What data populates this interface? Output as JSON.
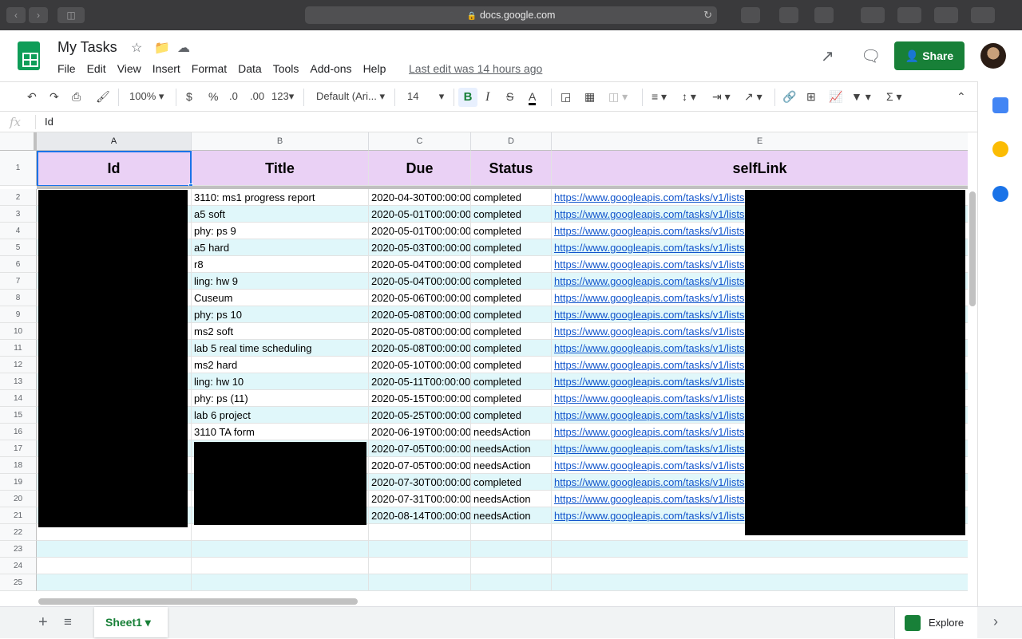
{
  "browser": {
    "url": "docs.google.com"
  },
  "header": {
    "title": "My Tasks",
    "menus": [
      "File",
      "Edit",
      "View",
      "Insert",
      "Format",
      "Data",
      "Tools",
      "Add-ons",
      "Help"
    ],
    "last_edit": "Last edit was 14 hours ago",
    "share_label": "Share"
  },
  "toolbar": {
    "zoom": "100%",
    "currency": "$",
    "percent": "%",
    "dec_less": ".0",
    "dec_more": ".00",
    "more_formats": "123",
    "font": "Default (Ari...",
    "font_size": "14",
    "bold": "B",
    "italic": "I",
    "strike": "S",
    "textcolor": "A"
  },
  "formula_bar": {
    "fx": "fx",
    "value": "Id"
  },
  "columns": [
    "A",
    "B",
    "C",
    "D",
    "E"
  ],
  "header_row": [
    "Id",
    "Title",
    "Due",
    "Status",
    "selfLink"
  ],
  "rows": [
    [
      "",
      "3110: ms1 progress report",
      "2020-04-30T00:00:00",
      "completed",
      "https://www.googleapis.com/tasks/v1/lists"
    ],
    [
      "",
      "a5 soft",
      "2020-05-01T00:00:00",
      "completed",
      "https://www.googleapis.com/tasks/v1/lists"
    ],
    [
      "",
      "phy: ps 9",
      "2020-05-01T00:00:00",
      "completed",
      "https://www.googleapis.com/tasks/v1/lists"
    ],
    [
      "",
      "a5 hard",
      "2020-05-03T00:00:00",
      "completed",
      "https://www.googleapis.com/tasks/v1/lists"
    ],
    [
      "",
      "r8",
      "2020-05-04T00:00:00",
      "completed",
      "https://www.googleapis.com/tasks/v1/lists"
    ],
    [
      "",
      "ling: hw 9",
      "2020-05-04T00:00:00",
      "completed",
      "https://www.googleapis.com/tasks/v1/lists"
    ],
    [
      "",
      "Cuseum",
      "2020-05-06T00:00:00",
      "completed",
      "https://www.googleapis.com/tasks/v1/lists"
    ],
    [
      "",
      "phy: ps 10",
      "2020-05-08T00:00:00",
      "completed",
      "https://www.googleapis.com/tasks/v1/lists"
    ],
    [
      "",
      "ms2 soft",
      "2020-05-08T00:00:00",
      "completed",
      "https://www.googleapis.com/tasks/v1/lists"
    ],
    [
      "",
      "lab 5 real time scheduling",
      "2020-05-08T00:00:00",
      "completed",
      "https://www.googleapis.com/tasks/v1/lists"
    ],
    [
      "",
      "ms2 hard",
      "2020-05-10T00:00:00",
      "completed",
      "https://www.googleapis.com/tasks/v1/lists"
    ],
    [
      "",
      "ling: hw 10",
      "2020-05-11T00:00:00",
      "completed",
      "https://www.googleapis.com/tasks/v1/lists"
    ],
    [
      "",
      "phy: ps (11)",
      "2020-05-15T00:00:00",
      "completed",
      "https://www.googleapis.com/tasks/v1/lists"
    ],
    [
      "",
      "lab 6 project",
      "2020-05-25T00:00:00",
      "completed",
      "https://www.googleapis.com/tasks/v1/lists"
    ],
    [
      "",
      "3110 TA form",
      "2020-06-19T00:00:00",
      "needsAction",
      "https://www.googleapis.com/tasks/v1/lists"
    ],
    [
      "",
      "",
      "2020-07-05T00:00:00",
      "needsAction",
      "https://www.googleapis.com/tasks/v1/lists"
    ],
    [
      "",
      "",
      "2020-07-05T00:00:00",
      "needsAction",
      "https://www.googleapis.com/tasks/v1/lists"
    ],
    [
      "",
      "",
      "2020-07-30T00:00:00",
      "completed",
      "https://www.googleapis.com/tasks/v1/lists"
    ],
    [
      "",
      "",
      "2020-07-31T00:00:00",
      "needsAction",
      "https://www.googleapis.com/tasks/v1/lists"
    ],
    [
      "",
      "",
      "2020-08-14T00:00:00",
      "needsAction",
      "https://www.googleapis.com/tasks/v1/lists"
    ],
    [
      "",
      "",
      "",
      "",
      ""
    ],
    [
      "",
      "",
      "",
      "",
      ""
    ],
    [
      "",
      "",
      "",
      "",
      ""
    ],
    [
      "",
      "",
      "",
      "",
      ""
    ]
  ],
  "bottom": {
    "sheet_name": "Sheet1",
    "explore_label": "Explore"
  },
  "colors": {
    "header_fill": "#ead1f5",
    "band_fill": "#e0f7fa",
    "share": "#188038",
    "link": "#1155cc"
  }
}
